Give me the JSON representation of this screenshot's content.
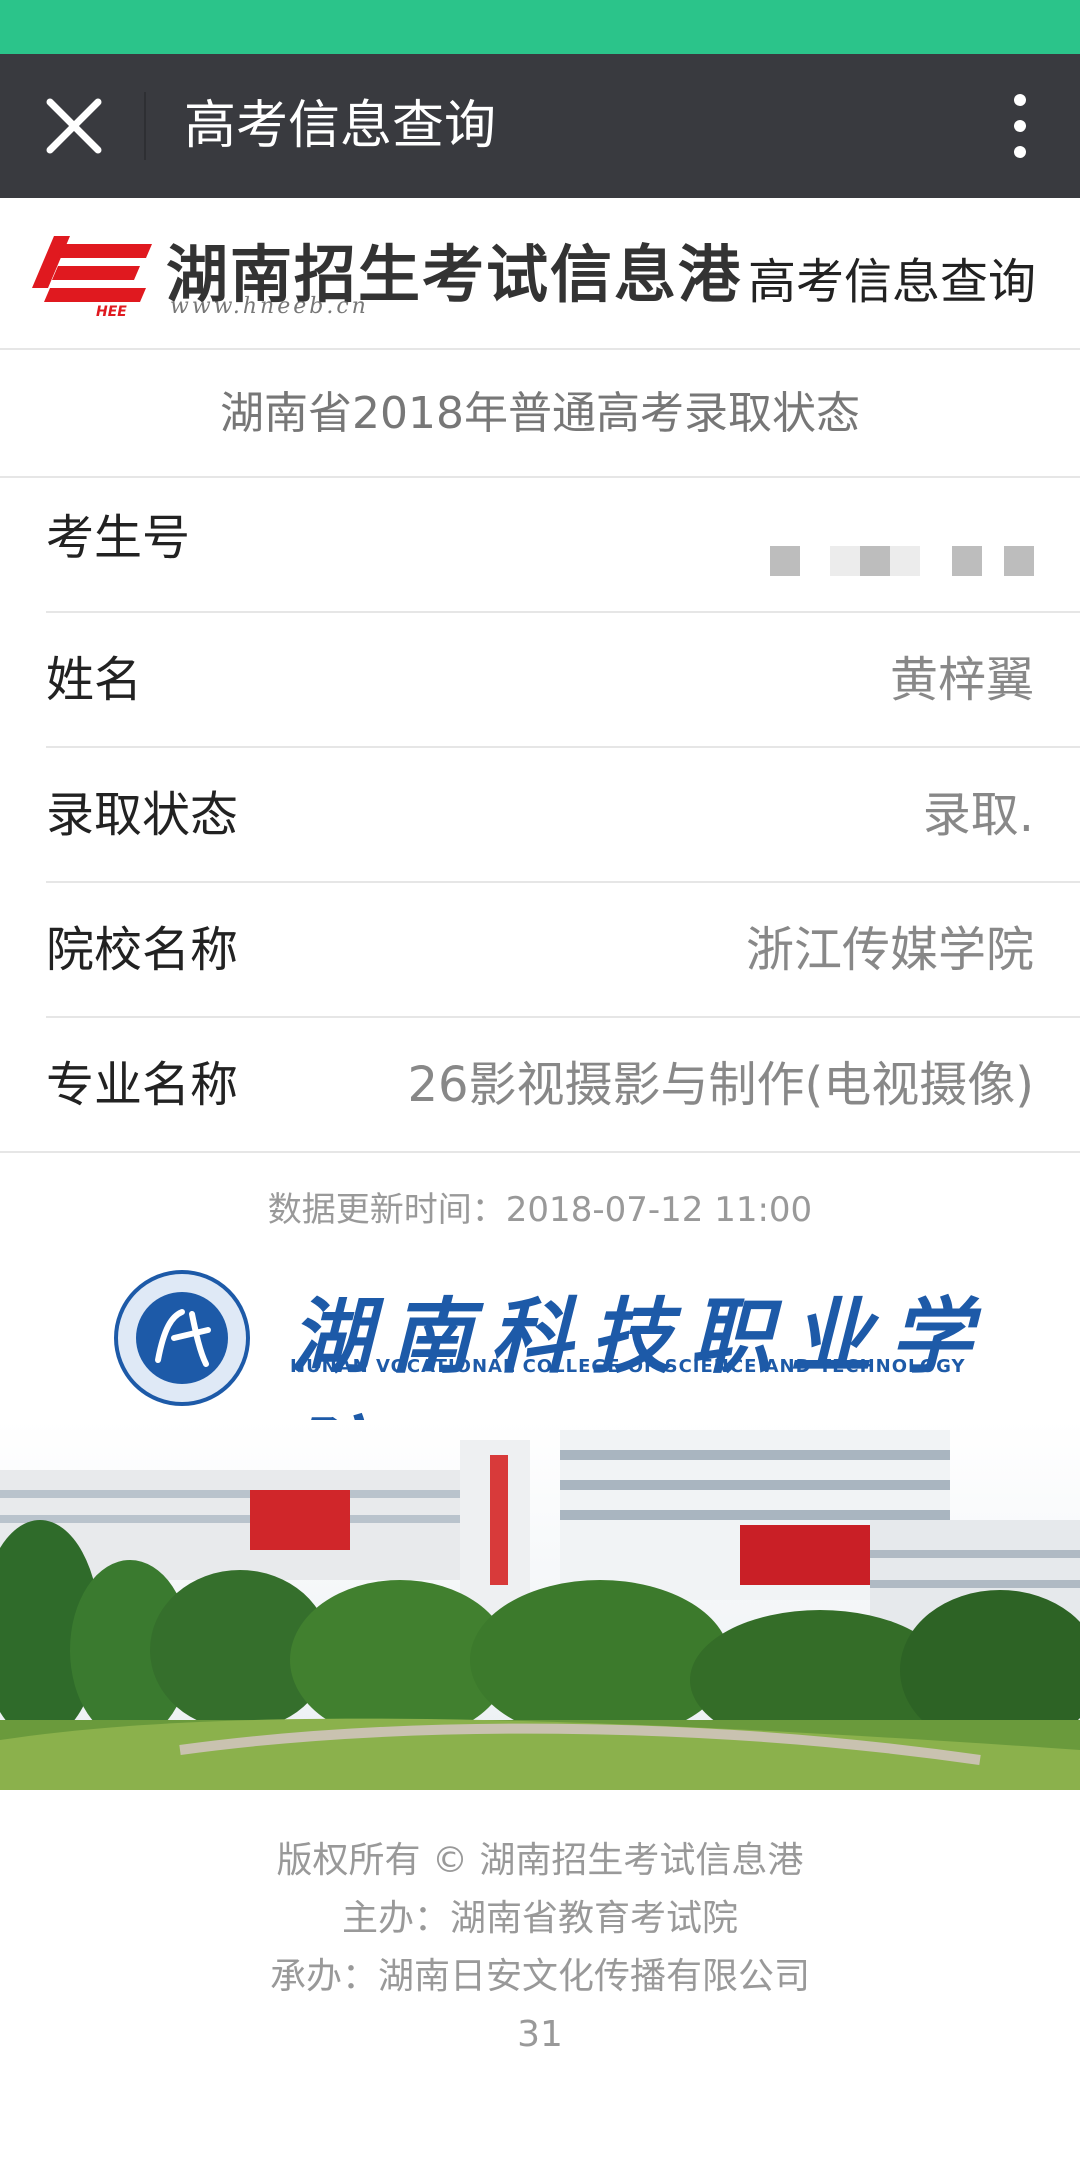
{
  "nav": {
    "title": "高考信息查询"
  },
  "header": {
    "logo_title": "湖南招生考试信息港",
    "logo_url": "www.hneeb.cn",
    "logo_mark_text": "HEE",
    "link": "高考信息查询"
  },
  "page": {
    "subtitle": "湖南省2018年普通高考录取状态"
  },
  "rows": [
    {
      "label": "考生号",
      "value": ""
    },
    {
      "label": "姓名",
      "value": "黄梓翼"
    },
    {
      "label": "录取状态",
      "value": "录取."
    },
    {
      "label": "院校名称",
      "value": "浙江传媒学院"
    },
    {
      "label": "专业名称",
      "value": "26影视摄影与制作(电视摄像)"
    }
  ],
  "update_time": "数据更新时间：2018-07-12 11:00",
  "college": {
    "name_cn": "湖南科技职业学院",
    "name_en": "HUNAN VOCATIONAL COLLEGE OF SCIENCE AND TECHNOLOGY"
  },
  "footer": {
    "copyright": "版权所有 © 湖南招生考试信息港",
    "host": "主办：湖南省教育考试院",
    "organizer": "承办：湖南日安文化传播有限公司",
    "count": "31"
  },
  "colors": {
    "status_bar": "#2bc48a",
    "nav_bar": "#393a3f",
    "brand_red": "#e0191f",
    "college_blue": "#1d5aa8"
  },
  "icons": {
    "close": "close-icon",
    "more": "more-vertical-icon"
  }
}
